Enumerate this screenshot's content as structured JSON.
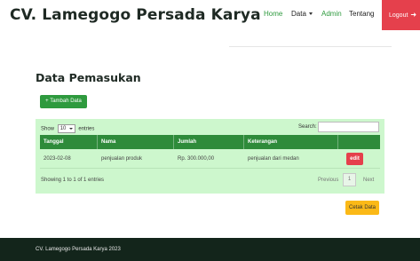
{
  "navbar": {
    "brand": "CV. Lamegogo Persada Karya",
    "links": {
      "home": "Home",
      "data": "Data",
      "admin": "Admin",
      "tentang": "Tentang"
    },
    "logout": "Logout",
    "logout_icon": "arrow-right-icon"
  },
  "page": {
    "title": "Data Pemasukan",
    "add_button": "+ Tambah Data",
    "print_button": "Cetak Data"
  },
  "table_controls": {
    "show_label": "Show",
    "entries_value": "10",
    "entries_label": "entries",
    "search_label": "Search:",
    "search_value": ""
  },
  "table": {
    "headers": [
      "Tanggal",
      "Nama",
      "Jumlah",
      "Keterangan",
      ""
    ],
    "rows": [
      {
        "tanggal": "2023-02-08",
        "nama": "penjualan produk",
        "jumlah": "Rp. 300.000,00",
        "keterangan": "penjualan dari medan",
        "action": "edit"
      }
    ]
  },
  "pagination": {
    "info": "Showing 1 to 1 of 1 entries",
    "previous": "Previous",
    "current": "1",
    "next": "Next"
  },
  "footer": {
    "text": "CV. Lamegogo Persada Karya 2023"
  },
  "colors": {
    "accent": "#2e9a3e",
    "danger": "#e5404c",
    "warning": "#fbb917",
    "panel": "#cdf7cd",
    "footer": "#13251b"
  }
}
